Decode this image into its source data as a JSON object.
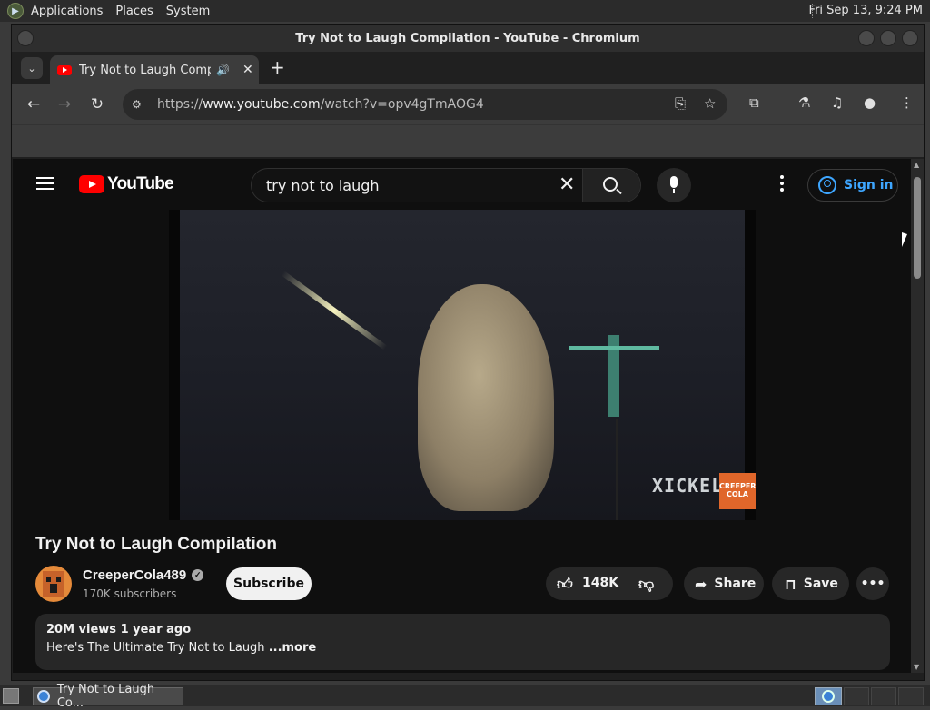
{
  "panel": {
    "menus": [
      "Applications",
      "Places",
      "System"
    ],
    "clock": "Fri Sep 13,  9:24 PM"
  },
  "window": {
    "title": "Try Not to Laugh Compilation - YouTube - Chromium"
  },
  "tab": {
    "title": "Try Not to Laugh Compil",
    "audio_icon": "speaker-icon",
    "close_glyph": "✕",
    "new_tab_glyph": "+"
  },
  "omnibox": {
    "url_prefix": "https://",
    "url_host": "www.youtube.com",
    "url_path": "/watch?v=opv4gTmAOG4"
  },
  "youtube": {
    "logo_text": "YouTube",
    "search_value": "try not to laugh",
    "sign_in": "Sign in",
    "video": {
      "watermark": "XICKEL",
      "badge": "CREEPER COLA"
    },
    "title": "Try Not to Laugh Compilation",
    "channel": "CreeperCola489",
    "subscribers": "170K subscribers",
    "subscribe_label": "Subscribe",
    "likes": "148K",
    "share_label": "Share",
    "save_label": "Save",
    "description": {
      "meta": "20M views  1 year ago",
      "text": "Here's The Ultimate Try Not to Laugh ",
      "more": "...more"
    }
  },
  "taskbar": {
    "task_label": "Try Not to Laugh Co..."
  },
  "colors": {
    "youtube_red": "#ff0000",
    "link_blue": "#3ea6ff",
    "page_bg": "#0f0f0f"
  }
}
